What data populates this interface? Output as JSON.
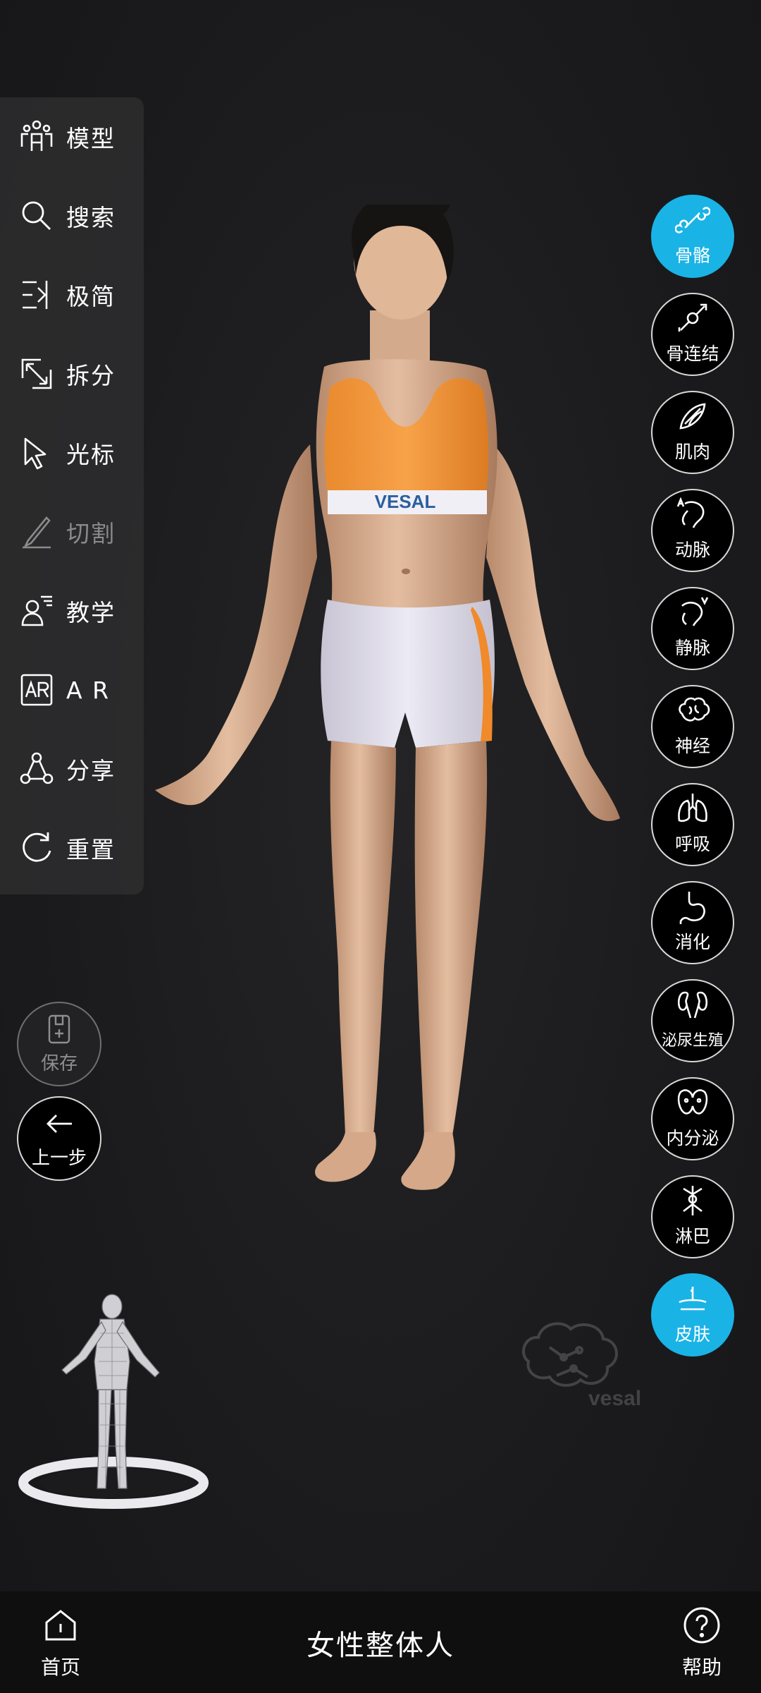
{
  "toolbar": {
    "items": [
      {
        "label": "模型",
        "icon": "people-icon"
      },
      {
        "label": "搜索",
        "icon": "search-icon"
      },
      {
        "label": "极简",
        "icon": "minimal-icon"
      },
      {
        "label": "拆分",
        "icon": "split-icon"
      },
      {
        "label": "光标",
        "icon": "cursor-icon"
      },
      {
        "label": "切割",
        "icon": "knife-icon",
        "disabled": true
      },
      {
        "label": "教学",
        "icon": "teacher-icon"
      },
      {
        "label": "A R",
        "icon": "ar-icon"
      },
      {
        "label": "分享",
        "icon": "share-icon"
      },
      {
        "label": "重置",
        "icon": "reset-icon"
      }
    ]
  },
  "actions": {
    "save_label": "保存",
    "back_label": "上一步"
  },
  "systems": {
    "items": [
      {
        "label": "骨骼",
        "icon": "bone-icon",
        "active": true
      },
      {
        "label": "骨连结",
        "icon": "joint-icon",
        "active": false
      },
      {
        "label": "肌肉",
        "icon": "muscle-icon",
        "active": false
      },
      {
        "label": "动脉",
        "icon": "artery-icon",
        "active": false
      },
      {
        "label": "静脉",
        "icon": "vein-icon",
        "active": false
      },
      {
        "label": "神经",
        "icon": "brain-icon",
        "active": false
      },
      {
        "label": "呼吸",
        "icon": "lungs-icon",
        "active": false
      },
      {
        "label": "消化",
        "icon": "stomach-icon",
        "active": false
      },
      {
        "label": "泌尿生殖",
        "icon": "kidney-icon",
        "active": false
      },
      {
        "label": "内分泌",
        "icon": "thyroid-icon",
        "active": false
      },
      {
        "label": "淋巴",
        "icon": "lymph-icon",
        "active": false
      },
      {
        "label": "皮肤",
        "icon": "skin-icon",
        "active": true
      }
    ]
  },
  "model": {
    "bra_brand": "VESAL"
  },
  "watermark": {
    "text": "vesal"
  },
  "bottom_nav": {
    "home_label": "首页",
    "title": "女性整体人",
    "help_label": "帮助"
  },
  "colors": {
    "accent": "#1ab3e6",
    "background": "#1c1c1e",
    "bottom_bar": "#0f0f10"
  }
}
